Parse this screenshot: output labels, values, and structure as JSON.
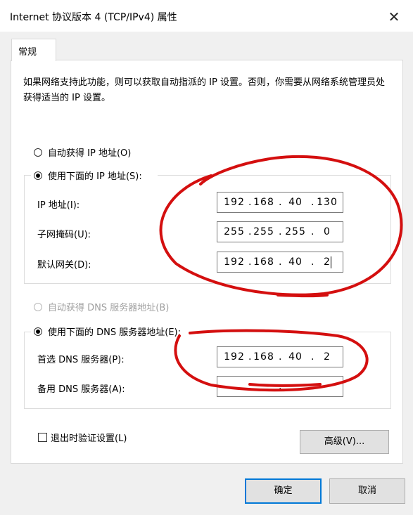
{
  "window": {
    "title": "Internet 协议版本 4 (TCP/IPv4) 属性",
    "close_glyph": "✕"
  },
  "tabs": [
    {
      "label": "常规"
    }
  ],
  "description": "如果网络支持此功能，则可以获取自动指派的 IP 设置。否则，你需要从网络系统管理员处获得适当的 IP 设置。",
  "ip": {
    "auto_label": "自动获得 IP 地址(O)",
    "manual_label": "使用下面的 IP 地址(S):",
    "address_label": "IP 地址(I):",
    "address": [
      "192",
      "168",
      "40",
      "130"
    ],
    "subnet_label": "子网掩码(U):",
    "subnet": [
      "255",
      "255",
      "255",
      "0"
    ],
    "gateway_label": "默认网关(D):",
    "gateway": [
      "192",
      "168",
      "40",
      "2"
    ]
  },
  "dns": {
    "auto_label": "自动获得 DNS 服务器地址(B)",
    "manual_label": "使用下面的 DNS 服务器地址(E):",
    "preferred_label": "首选 DNS 服务器(P):",
    "preferred": [
      "192",
      "168",
      "40",
      "2"
    ],
    "alternate_label": "备用 DNS 服务器(A):",
    "alternate": [
      "",
      "",
      "",
      ""
    ]
  },
  "validate_label": "退出时验证设置(L)",
  "buttons": {
    "advanced": "高级(V)...",
    "ok": "确定",
    "cancel": "取消"
  },
  "colors": {
    "annotation": "#d40f0f",
    "focus_border": "#0078d7"
  }
}
